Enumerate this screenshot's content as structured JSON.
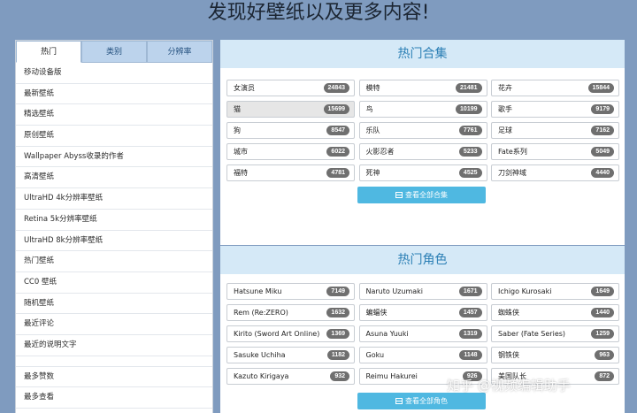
{
  "banner": "发现好壁纸以及更多内容!",
  "sidebar": {
    "tabs": [
      "热门",
      "类别",
      "分辨率"
    ],
    "items": [
      "移动设备版",
      "最新壁纸",
      "精选壁纸",
      "原创壁纸",
      "Wallpaper Abyss收录的作者",
      "高清壁纸",
      "UltraHD 4k分辨率壁纸",
      "Retina 5k分辨率壁纸",
      "UltraHD 8k分辨率壁纸",
      "热门壁纸",
      "CC0 壁纸",
      "随机壁纸",
      "最近评论",
      "最近的说明文字"
    ],
    "items2": [
      "最多赞数",
      "最多查看"
    ]
  },
  "collections": {
    "title": "热门合集",
    "tags": [
      {
        "label": "女演员",
        "count": "24843"
      },
      {
        "label": "模特",
        "count": "21481"
      },
      {
        "label": "花卉",
        "count": "15844"
      },
      {
        "label": "猫",
        "count": "15699"
      },
      {
        "label": "鸟",
        "count": "10199"
      },
      {
        "label": "歌手",
        "count": "9179"
      },
      {
        "label": "狗",
        "count": "8547"
      },
      {
        "label": "乐队",
        "count": "7761"
      },
      {
        "label": "足球",
        "count": "7162"
      },
      {
        "label": "城市",
        "count": "6022"
      },
      {
        "label": "火影忍者",
        "count": "5233"
      },
      {
        "label": "Fate系列",
        "count": "5049"
      },
      {
        "label": "福特",
        "count": "4781"
      },
      {
        "label": "死神",
        "count": "4525"
      },
      {
        "label": "刀剑神域",
        "count": "4440"
      }
    ],
    "button": "查看全部合集"
  },
  "characters": {
    "title": "热门角色",
    "tags": [
      {
        "label": "Hatsune Miku",
        "count": "7149"
      },
      {
        "label": "Naruto Uzumaki",
        "count": "1671"
      },
      {
        "label": "Ichigo Kurosaki",
        "count": "1649"
      },
      {
        "label": "Rem (Re:ZERO)",
        "count": "1632"
      },
      {
        "label": "蝙蝠侠",
        "count": "1457"
      },
      {
        "label": "蜘蛛侠",
        "count": "1440"
      },
      {
        "label": "Kirito (Sword Art Online)",
        "count": "1369"
      },
      {
        "label": "Asuna Yuuki",
        "count": "1319"
      },
      {
        "label": "Saber (Fate Series)",
        "count": "1259"
      },
      {
        "label": "Sasuke Uchiha",
        "count": "1182"
      },
      {
        "label": "Goku",
        "count": "1148"
      },
      {
        "label": "钢铁侠",
        "count": "963"
      },
      {
        "label": "Kazuto Kirigaya",
        "count": "932"
      },
      {
        "label": "Reimu Hakurei",
        "count": "926"
      },
      {
        "label": "美国队长",
        "count": "872"
      }
    ],
    "button": "查看全部角色"
  },
  "watermark": "知乎 @视频编辑助手"
}
